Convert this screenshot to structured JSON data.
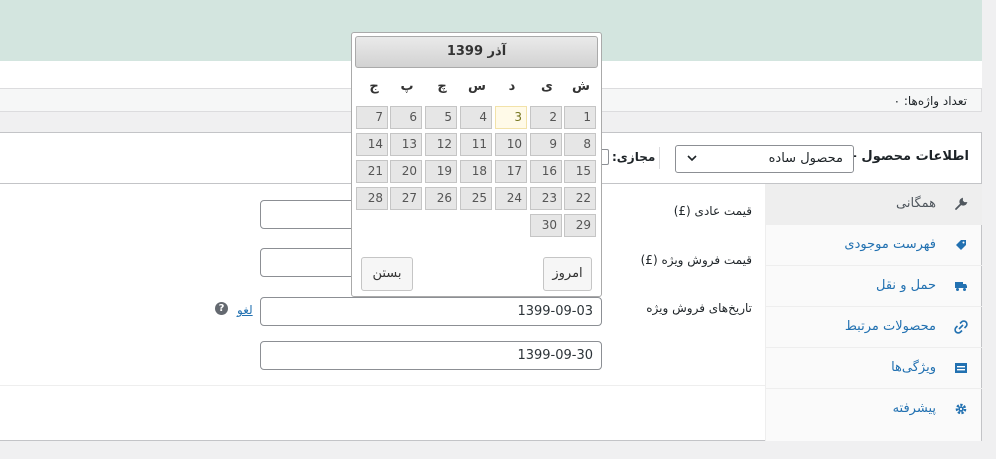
{
  "editor": {
    "word_count": "تعداد واژه‌ها: ۰"
  },
  "product_data": {
    "title": "اطلاعات محصول —",
    "type_select": "محصول ساده",
    "virtual_label": "مجازی:"
  },
  "tabs": [
    {
      "label": "همگانی",
      "icon": "wrench-icon",
      "active": true
    },
    {
      "label": "فهرست موجودی",
      "icon": "tag-icon",
      "active": false
    },
    {
      "label": "حمل و نقل",
      "icon": "truck-icon",
      "active": false
    },
    {
      "label": "محصولات مرتبط",
      "icon": "link-icon",
      "active": false
    },
    {
      "label": "ویژگی‌ها",
      "icon": "list-icon",
      "active": false
    },
    {
      "label": "پیشرفته",
      "icon": "gear-icon",
      "active": false
    }
  ],
  "fields": {
    "regular_price_label": "قیمت عادی (£)",
    "sale_price_label": "قیمت فروش ویژه (£)",
    "sale_dates_label": "تاریخ‌های فروش ویژه",
    "date_from": "1399-09-03",
    "date_to": "1399-09-30",
    "cancel_link": "لغو",
    "help_glyph": "?"
  },
  "calendar": {
    "title": "آذر 1399",
    "weekdays": [
      "ش",
      "ی",
      "د",
      "س",
      "چ",
      "پ",
      "ج"
    ],
    "days": [
      "1",
      "2",
      "3",
      "4",
      "5",
      "6",
      "7",
      "8",
      "9",
      "10",
      "11",
      "12",
      "13",
      "14",
      "15",
      "16",
      "17",
      "18",
      "19",
      "20",
      "21",
      "22",
      "23",
      "24",
      "25",
      "26",
      "27",
      "28",
      "29",
      "30"
    ],
    "today": "3",
    "today_button": "امروز",
    "close_button": "بستن"
  }
}
